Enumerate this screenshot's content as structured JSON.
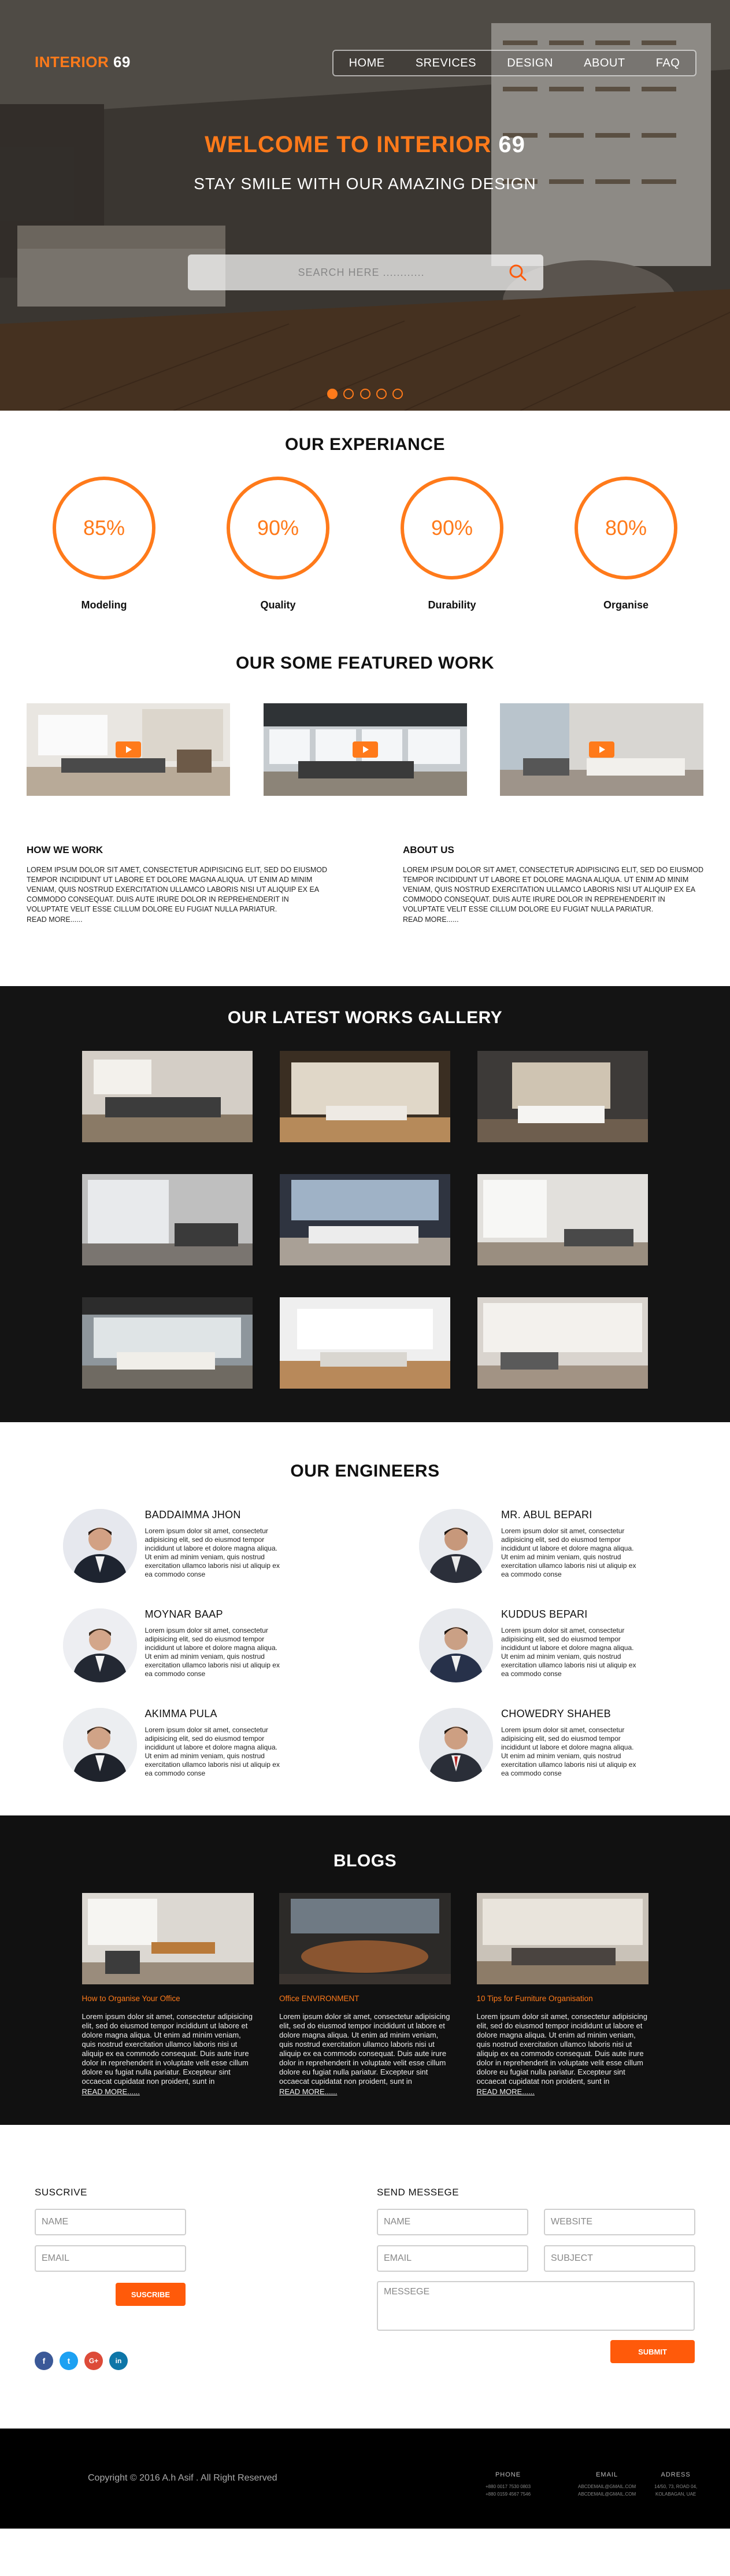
{
  "brand": {
    "part1": "INTERIOR",
    "part2": "69"
  },
  "nav": [
    "HOME",
    "SREVICES",
    "DESIGN",
    "ABOUT",
    "FAQ"
  ],
  "hero": {
    "title_part1": "WELCOME TO INTERIOR",
    "title_part2": "69",
    "subtitle": "STAY SMILE WITH OUR AMAZING DESIGN",
    "search_placeholder": "SEARCH HERE ............",
    "slides": 5,
    "active_slide": 1
  },
  "experience": {
    "title": "OUR EXPERIANCE",
    "stats": [
      {
        "value": "85%",
        "label": "Modeling"
      },
      {
        "value": "90%",
        "label": "Quality"
      },
      {
        "value": "90%",
        "label": "Durability"
      },
      {
        "value": "80%",
        "label": "Organise"
      }
    ]
  },
  "featured": {
    "title": "OUR SOME FEATURED WORK"
  },
  "how_we_work": {
    "title": "HOW WE WORK",
    "text": "LOREM IPSUM DOLOR SIT AMET, CONSECTETUR ADIPISICING ELIT, SED DO EIUSMOD TEMPOR INCIDIDUNT UT LABORE ET DOLORE MAGNA ALIQUA. UT ENIM AD MINIM VENIAM, QUIS NOSTRUD EXERCITATION ULLAMCO LABORIS NISI UT ALIQUIP EX EA COMMODO CONSEQUAT. DUIS AUTE IRURE DOLOR IN REPREHENDERIT IN VOLUPTATE VELIT ESSE CILLUM DOLORE EU FUGIAT NULLA PARIATUR.",
    "more": "READ MORE......"
  },
  "about_us": {
    "title": "ABOUT US",
    "text": "LOREM IPSUM DOLOR SIT AMET, CONSECTETUR ADIPISICING ELIT, SED DO EIUSMOD TEMPOR INCIDIDUNT UT LABORE ET DOLORE MAGNA ALIQUA. UT ENIM AD MINIM VENIAM, QUIS NOSTRUD EXERCITATION ULLAMCO LABORIS NISI UT ALIQUIP EX EA COMMODO CONSEQUAT. DUIS AUTE IRURE DOLOR IN REPREHENDERIT IN VOLUPTATE VELIT ESSE CILLUM DOLORE EU FUGIAT NULLA PARIATUR.",
    "more": "READ MORE......"
  },
  "gallery": {
    "title": "OUR LATEST WORKS GALLERY"
  },
  "engineers": {
    "title": "OUR ENGINEERS",
    "bio": "Lorem ipsum dolor sit amet, consectetur adipisicing elit, sed do eiusmod tempor incididunt ut labore et dolore magna aliqua. Ut enim ad minim veniam, quis nostrud exercitation ullamco laboris nisi ut aliquip ex ea commodo conse",
    "people": [
      {
        "name": "BADDAIMMA JHON"
      },
      {
        "name": "MR. ABUL BEPARI"
      },
      {
        "name": "MOYNAR BAAP"
      },
      {
        "name": "KUDDUS BEPARI"
      },
      {
        "name": "AKIMMA PULA"
      },
      {
        "name": "CHOWEDRY SHAHEB"
      }
    ]
  },
  "blogs": {
    "title": "BLOGS",
    "text": "Lorem ipsum dolor sit amet, consectetur adipisicing elit, sed do eiusmod tempor incididunt ut labore et dolore magna aliqua. Ut enim ad minim veniam, quis nostrud exercitation ullamco laboris nisi ut aliquip ex ea commodo consequat. Duis aute irure dolor in reprehenderit in voluptate velit esse cillum dolore eu fugiat nulla pariatur. Excepteur sint occaecat cupidatat non proident, sunt in",
    "more": "READ MORE......",
    "posts": [
      {
        "title": "How to Organise Your Office"
      },
      {
        "title": "Office ENVIRONMENT"
      },
      {
        "title": "10 Tips for Furniture Organisation"
      }
    ]
  },
  "subscribe": {
    "title": "SUSCRIVE",
    "name_placeholder": "NAME",
    "email_placeholder": "EMAIL",
    "button": "SUSCRIBE"
  },
  "message": {
    "title": "SEND MESSEGE",
    "name_placeholder": "NAME",
    "website_placeholder": "WEBSITE",
    "email_placeholder": "EMAIL",
    "subject_placeholder": "SUBJECT",
    "message_placeholder": "MESSEGE",
    "button": "SUBMIT"
  },
  "social": [
    {
      "icon": "facebook-icon",
      "glyph": "f",
      "color": "#3b5998"
    },
    {
      "icon": "twitter-icon",
      "glyph": "t",
      "color": "#1da1f2"
    },
    {
      "icon": "google-plus-icon",
      "glyph": "G+",
      "color": "#dd4b39"
    },
    {
      "icon": "linkedin-icon",
      "glyph": "in",
      "color": "#0e76a8"
    }
  ],
  "footer": {
    "copyright": "Copyright © 2016 A.h Asif . All Right Reserved",
    "phone_label": "PHONE",
    "phone_lines": [
      "+880 0017 7530 0803",
      "+880 0159 4567 7546"
    ],
    "email_label": "EMAIL",
    "email_lines": [
      "ABCDEMAIL@GMAIL.COM",
      "ABCDEMAIL@GMAIL.COM"
    ],
    "address_label": "ADRESS",
    "address_lines": [
      "14/50, 73, ROAD 04,",
      "KOLABAGAN, UAE"
    ]
  },
  "colors": {
    "accent": "#ff7a1a",
    "button": "#ff5a0a",
    "dark": "#141414"
  }
}
